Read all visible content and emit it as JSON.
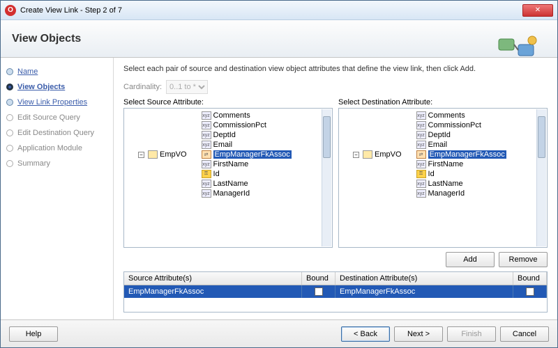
{
  "window": {
    "title": "Create View Link - Step 2 of 7"
  },
  "header": {
    "title": "View Objects"
  },
  "sidebar": {
    "steps": [
      {
        "label": "Name",
        "state": "done"
      },
      {
        "label": "View Objects",
        "state": "active"
      },
      {
        "label": "View Link Properties",
        "state": "done"
      },
      {
        "label": "Edit Source Query",
        "state": "disabled"
      },
      {
        "label": "Edit Destination Query",
        "state": "disabled"
      },
      {
        "label": "Application Module",
        "state": "disabled"
      },
      {
        "label": "Summary",
        "state": "disabled"
      }
    ]
  },
  "main": {
    "instructions": "Select each pair of source and destination view object attributes that define the view link, then click Add.",
    "cardinality_label": "Cardinality:",
    "cardinality_value": "0..1 to *",
    "source_label": "Select Source Attribute:",
    "dest_label": "Select Destination Attribute:",
    "tree_root": "EmpVO",
    "tree_items": [
      {
        "label": "Comments",
        "kind": "xyz"
      },
      {
        "label": "CommissionPct",
        "kind": "xyz"
      },
      {
        "label": "DeptId",
        "kind": "xyz"
      },
      {
        "label": "Email",
        "kind": "xyz"
      },
      {
        "label": "EmpManagerFkAssoc",
        "kind": "assoc",
        "selected": true
      },
      {
        "label": "FirstName",
        "kind": "xyz"
      },
      {
        "label": "Id",
        "kind": "key"
      },
      {
        "label": "LastName",
        "kind": "xyz"
      },
      {
        "label": "ManagerId",
        "kind": "xyz"
      }
    ],
    "add_btn": "Add",
    "remove_btn": "Remove",
    "table": {
      "cols": [
        "Source Attribute(s)",
        "Bound",
        "Destination Attribute(s)",
        "Bound"
      ],
      "row": {
        "src": "EmpManagerFkAssoc",
        "dst": "EmpManagerFkAssoc"
      }
    }
  },
  "footer": {
    "help": "Help",
    "back": "< Back",
    "next": "Next >",
    "finish": "Finish",
    "cancel": "Cancel"
  }
}
